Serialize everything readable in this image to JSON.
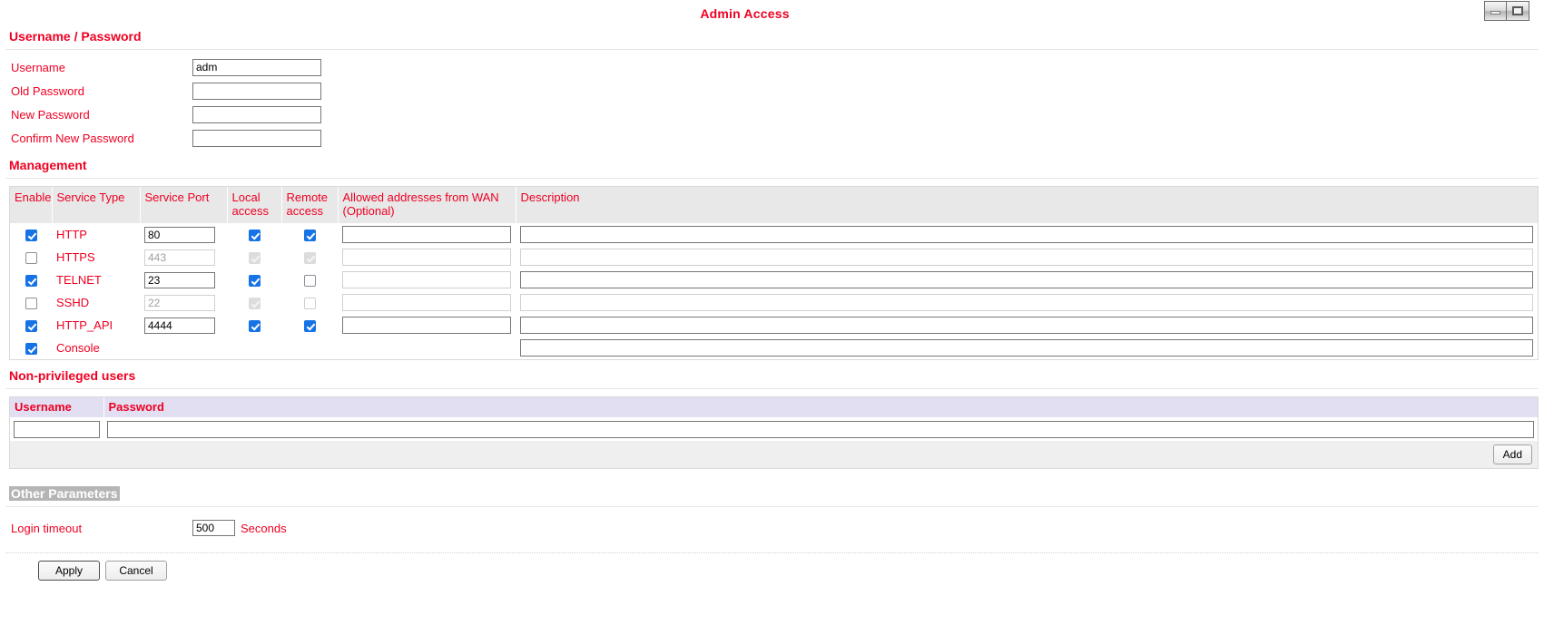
{
  "window_controls": {
    "minimize": {
      "icon": "window-minimize-icon"
    },
    "maximize": {
      "icon": "window-maximize-icon"
    }
  },
  "header": {
    "title": "Admin Access"
  },
  "sections": {
    "credentials": {
      "heading": "Username / Password",
      "fields": [
        {
          "label": "Username",
          "value": "adm",
          "placeholder": ""
        },
        {
          "label": "Old Password",
          "value": "",
          "placeholder": ""
        },
        {
          "label": "New Password",
          "value": "",
          "placeholder": ""
        },
        {
          "label": "Confirm New Password",
          "value": "",
          "placeholder": ""
        }
      ]
    },
    "management": {
      "heading": "Management",
      "columns": [
        "Enable",
        "Service Type",
        "Service Port",
        "Local access",
        "Remote access",
        "Allowed addresses from WAN (Optional)",
        "Description"
      ],
      "rows": [
        {
          "service": "HTTP",
          "enabled": true,
          "port": "80",
          "port_disabled": false,
          "local_access": true,
          "local_disabled": false,
          "remote_access": true,
          "remote_disabled": false,
          "wan": "",
          "wan_disabled": false,
          "description": "",
          "desc_disabled": false,
          "has_port": true,
          "has_access": true,
          "has_wan": true
        },
        {
          "service": "HTTPS",
          "enabled": false,
          "port": "443",
          "port_disabled": true,
          "local_access": true,
          "local_disabled": true,
          "remote_access": true,
          "remote_disabled": true,
          "wan": "",
          "wan_disabled": true,
          "description": "",
          "desc_disabled": true,
          "has_port": true,
          "has_access": true,
          "has_wan": true
        },
        {
          "service": "TELNET",
          "enabled": true,
          "port": "23",
          "port_disabled": false,
          "local_access": true,
          "local_disabled": false,
          "remote_access": false,
          "remote_disabled": false,
          "wan": "",
          "wan_disabled": true,
          "description": "",
          "desc_disabled": false,
          "has_port": true,
          "has_access": true,
          "has_wan": true
        },
        {
          "service": "SSHD",
          "enabled": false,
          "port": "22",
          "port_disabled": true,
          "local_access": true,
          "local_disabled": true,
          "remote_access": false,
          "remote_disabled": true,
          "wan": "",
          "wan_disabled": true,
          "description": "",
          "desc_disabled": true,
          "has_port": true,
          "has_access": true,
          "has_wan": true
        },
        {
          "service": "HTTP_API",
          "enabled": true,
          "port": "4444",
          "port_disabled": false,
          "local_access": true,
          "local_disabled": false,
          "remote_access": true,
          "remote_disabled": false,
          "wan": "",
          "wan_disabled": false,
          "description": "",
          "desc_disabled": false,
          "has_port": true,
          "has_access": true,
          "has_wan": true
        },
        {
          "service": "Console",
          "enabled": true,
          "port": "",
          "port_disabled": true,
          "local_access": false,
          "local_disabled": true,
          "remote_access": false,
          "remote_disabled": true,
          "wan": "",
          "wan_disabled": true,
          "description": "",
          "desc_disabled": false,
          "has_port": false,
          "has_access": false,
          "has_wan": false
        }
      ]
    },
    "non_privileged_users": {
      "heading": "Non-privileged users",
      "columns": [
        "Username",
        "Password"
      ],
      "rows": [
        {
          "username": "",
          "password": ""
        }
      ],
      "add_label": "Add"
    },
    "other_parameters": {
      "heading": "Other Parameters",
      "login_timeout": {
        "label": "Login timeout",
        "value": "500",
        "unit": "Seconds"
      }
    }
  },
  "footer": {
    "apply_label": "Apply",
    "cancel_label": "Cancel"
  },
  "colors": {
    "label_red": "#ee0022",
    "checkbox_blue": "#1673e6",
    "mg_header_bg": "#e8e8e8",
    "np_header_bg": "#e2dff2",
    "selection_bg": "#b5b5b5"
  }
}
